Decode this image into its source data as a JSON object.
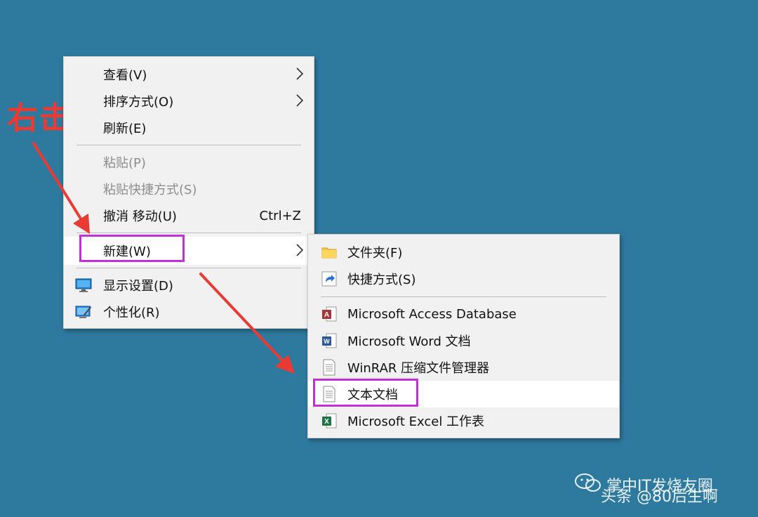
{
  "annotation": {
    "right_click_label": "右击"
  },
  "context_menu": {
    "items": [
      {
        "label": "查看(V)",
        "submenu": true
      },
      {
        "label": "排序方式(O)",
        "submenu": true
      },
      {
        "label": "刷新(E)"
      },
      {
        "label": "粘贴(P)",
        "disabled": true
      },
      {
        "label": "粘贴快捷方式(S)",
        "disabled": true
      },
      {
        "label": "撤消 移动(U)",
        "shortcut": "Ctrl+Z"
      },
      {
        "label": "新建(W)",
        "submenu": true,
        "highlighted": true
      },
      {
        "label": "显示设置(D)",
        "icon": "display-settings-icon"
      },
      {
        "label": "个性化(R)",
        "icon": "personalize-icon"
      }
    ]
  },
  "new_submenu": {
    "items": [
      {
        "label": "文件夹(F)",
        "icon": "folder-icon"
      },
      {
        "label": "快捷方式(S)",
        "icon": "shortcut-icon"
      },
      {
        "label": "Microsoft Access Database",
        "icon": "access-icon"
      },
      {
        "label": "Microsoft Word 文档",
        "icon": "word-icon"
      },
      {
        "label": "WinRAR 压缩文件管理器",
        "icon": "winrar-doc-icon"
      },
      {
        "label": "文本文档",
        "icon": "text-document-icon",
        "highlighted": true
      },
      {
        "label": "Microsoft Excel 工作表",
        "icon": "excel-icon"
      }
    ]
  },
  "watermark": {
    "line1": "掌中IT发烧友圈",
    "line2": "头条 @80后生啊"
  },
  "colors": {
    "desktop": "#2e7a9e",
    "menu_bg": "#f1f1f1",
    "highlight_box": "#c42fd8",
    "arrow": "#ea3a34"
  }
}
